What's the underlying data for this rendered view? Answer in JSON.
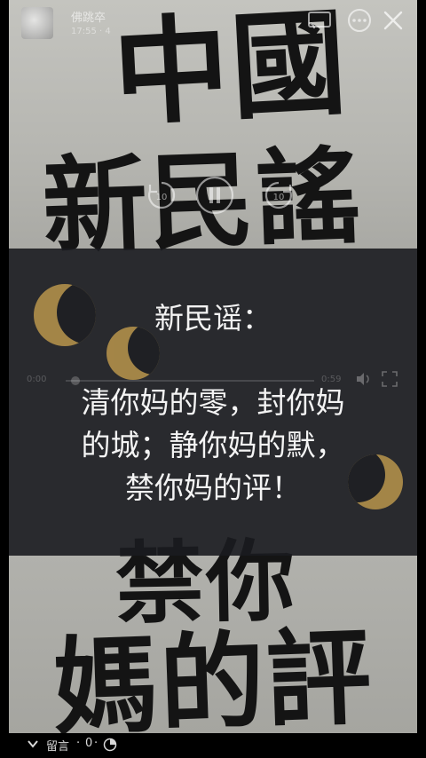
{
  "header": {
    "user_name": "佛跳卒",
    "user_meta": "17:55 · 4",
    "cast_icon": "cast-icon",
    "more_icon": "more-icon",
    "close_icon": "close-icon"
  },
  "background": {
    "calligraphy_line1": "中國",
    "calligraphy_line2": "新民謠",
    "calligraphy_line3": "禁你",
    "calligraphy_line4": "媽的評"
  },
  "video": {
    "time_elapsed": "0:00",
    "time_total": "0:59",
    "rewind_label": "10",
    "forward_label": "10"
  },
  "caption": {
    "title": "新民谣：",
    "lines": [
      "清你妈的零，封你妈",
      "的城；静你妈的默，",
      "禁你妈的评！"
    ]
  },
  "footer": {
    "comment_label": "留言",
    "separator": "·",
    "comment_count": "0"
  },
  "colors": {
    "overlay": "#1e2024",
    "moon": "#b18f4a",
    "paper": "#b7b7b3",
    "ink": "#141414"
  }
}
